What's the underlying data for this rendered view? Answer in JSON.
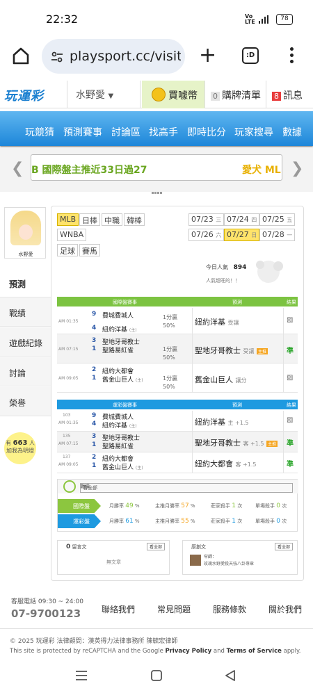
{
  "status": {
    "time": "22:32",
    "signal": "Vo LTE 4G",
    "battery": "78"
  },
  "browser": {
    "url": "playsport.cc/visit",
    "tab_count": ":D"
  },
  "site": {
    "logo": "玩運彩",
    "user": "水野愛",
    "coin_label": "買噱幣",
    "cart_count": "0",
    "cart_label": "購牌清單",
    "msg_count": "8",
    "msg_label": "訊息"
  },
  "nav": [
    "玩競猜",
    "預測賽事",
    "討論區",
    "找高手",
    "即時比分",
    "玩家搜尋",
    "數據"
  ],
  "carousel": {
    "text1": "B 國際盤主推近33日過27",
    "text2": "愛犬 MLB"
  },
  "sidebar": {
    "name": "水野愛",
    "tabs": [
      "預測",
      "戰績",
      "遊戲紀錄",
      "討論",
      "榮譽"
    ],
    "fans_prefix": "有",
    "fans_count": "663",
    "fans_suffix": "人",
    "fans_label": "加我為明燈"
  },
  "leagues": [
    "MLB",
    "日棒",
    "中職",
    "韓棒",
    "WNBA",
    "足球",
    "賽馬"
  ],
  "dates": [
    {
      "date": "07/23",
      "day": "三"
    },
    {
      "date": "07/24",
      "day": "四"
    },
    {
      "date": "07/25",
      "day": "五"
    },
    {
      "date": "07/26",
      "day": "六"
    },
    {
      "date": "07/27",
      "day": "日"
    },
    {
      "date": "07/28",
      "day": "一"
    }
  ],
  "popularity": {
    "label": "今日人氣",
    "value": "894",
    "sub": "人氣超旺的！！"
  },
  "intl": {
    "header": [
      "國際盤賽事",
      "預測",
      "結果"
    ],
    "rows": [
      {
        "time": "AM 01:35",
        "s1": "9",
        "t1": "費城費城人",
        "s2": "4",
        "t2": "紐約洋基",
        "line": "1分贏",
        "pct": "50%",
        "pick": "紐約洋基",
        "pick_note": "受讓",
        "res": "▨"
      },
      {
        "time": "AM 07:15",
        "s1": "3",
        "t1": "聖地牙哥教士",
        "s2": "1",
        "t2": "聖路易紅雀",
        "line": "1分贏",
        "pct": "50%",
        "pick": "聖地牙哥教士",
        "pick_note": "受讓",
        "res": "準"
      },
      {
        "time": "AM 09:05",
        "s1": "2",
        "t1": "紐約大都會",
        "s2": "1",
        "t2": "舊金山巨人",
        "line": "1分贏",
        "pct": "50%",
        "pick": "舊金山巨人",
        "pick_note": "讓分",
        "res": "▨"
      }
    ]
  },
  "local": {
    "header": [
      "運彩盤賽事",
      "預測",
      "結果"
    ],
    "rows": [
      {
        "num": "103",
        "time": "AM 01:35",
        "s1": "9",
        "t1": "費城費城人",
        "s2": "4",
        "t2": "紐約洋基",
        "pick": "紐約洋基",
        "pick_note": "主 +1.5",
        "res": "▨"
      },
      {
        "num": "135",
        "time": "AM 07:15",
        "s1": "3",
        "t1": "聖地牙哥教士",
        "s2": "1",
        "t2": "聖路易紅雀",
        "pick": "聖地牙哥教士",
        "pick_note": "客 +1.5",
        "res": "準"
      },
      {
        "num": "137",
        "time": "AM 09:05",
        "s1": "2",
        "t1": "紐約大都會",
        "s2": "1",
        "t2": "舊金山巨人",
        "pick": "紐約大都會",
        "pick_note": "客 +1.5",
        "res": "準"
      }
    ]
  },
  "record": {
    "title": "戰績",
    "more": "看全部",
    "rows": [
      {
        "label": "國際盤",
        "a": "月勝率",
        "av": "49",
        "b": "主推月勝率",
        "bv": "57",
        "c": "莊家殺手",
        "cv": "1",
        "d": "單場殺手",
        "dv": "0"
      },
      {
        "label": "運彩盤",
        "a": "月勝率",
        "av": "61",
        "b": "主推月勝率",
        "bv": "55",
        "c": "莊家殺手",
        "cv": "1",
        "d": "單場殺手",
        "dv": "0"
      }
    ]
  },
  "msgbox": {
    "count": "0",
    "label": "留言文",
    "more": "看全部",
    "empty": "無文章"
  },
  "postbox": {
    "label": "原創文",
    "more": "看全部",
    "item": "牢師：",
    "item2": "玫瑰水野愛殺天強八卦專章"
  },
  "footer": {
    "phone_label": "客服電話 09:30 ~ 24:00",
    "phone": "07-9700123",
    "links": [
      "聯絡我們",
      "常見問題",
      "服務條款",
      "關於我們"
    ],
    "legal1": "© 2025 玩運彩 法律顧問：漢英得力法律事務所 陳毓宏律師",
    "legal2a": "This site is protected by reCAPTCHA and the Google ",
    "legal2b": "Privacy Policy",
    "legal2c": " and ",
    "legal2d": "Terms of Service",
    "legal2e": " apply."
  }
}
